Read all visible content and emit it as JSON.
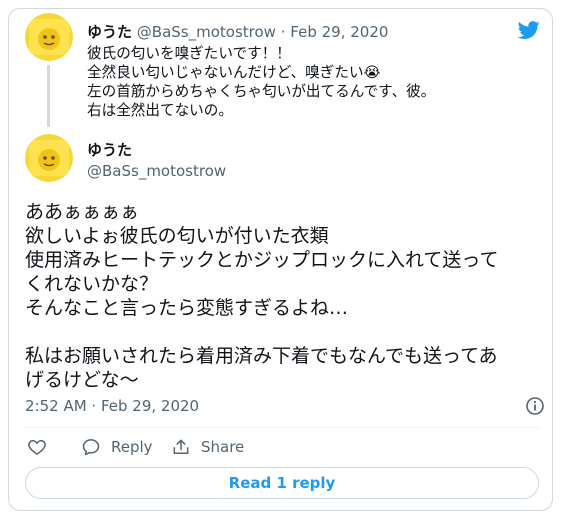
{
  "colors": {
    "brand": "#1d9bf0",
    "text": "#0f1419",
    "muted": "#536471",
    "border": "#cfd9de"
  },
  "quoted_tweet": {
    "name": "ゆうた",
    "handle": "@BaSs_motostrow",
    "separator": "·",
    "date": "Feb 29, 2020",
    "lines": [
      "彼氏の匂いを嗅ぎたいです！！",
      "全然良い匂いじゃないんだけど、嗅ぎたい😭",
      "左の首筋からめちゃくちゃ匂いが出てるんです、彼。",
      "右は全然出てないの。"
    ]
  },
  "main_tweet": {
    "name": "ゆうた",
    "handle": "@BaSs_motostrow",
    "lines": [
      "ああぁぁぁぁ",
      "欲しいよぉ彼氏の匂いが付いた衣類",
      "使用済みヒートテックとかジップロックに入れて送って",
      "くれないかな？",
      "そんなこと言ったら変態すぎるよね…",
      "",
      "私はお願いされたら着用済み下着でもなんでも送ってあ",
      "げるけどな〜"
    ],
    "timestamp": "2:52 AM · Feb 29, 2020"
  },
  "actions": {
    "reply_label": "Reply",
    "share_label": "Share"
  },
  "read_replies_label": "Read 1 reply",
  "icons": [
    "twitter-bird-icon",
    "info-icon",
    "heart-icon",
    "reply-icon",
    "share-icon"
  ]
}
